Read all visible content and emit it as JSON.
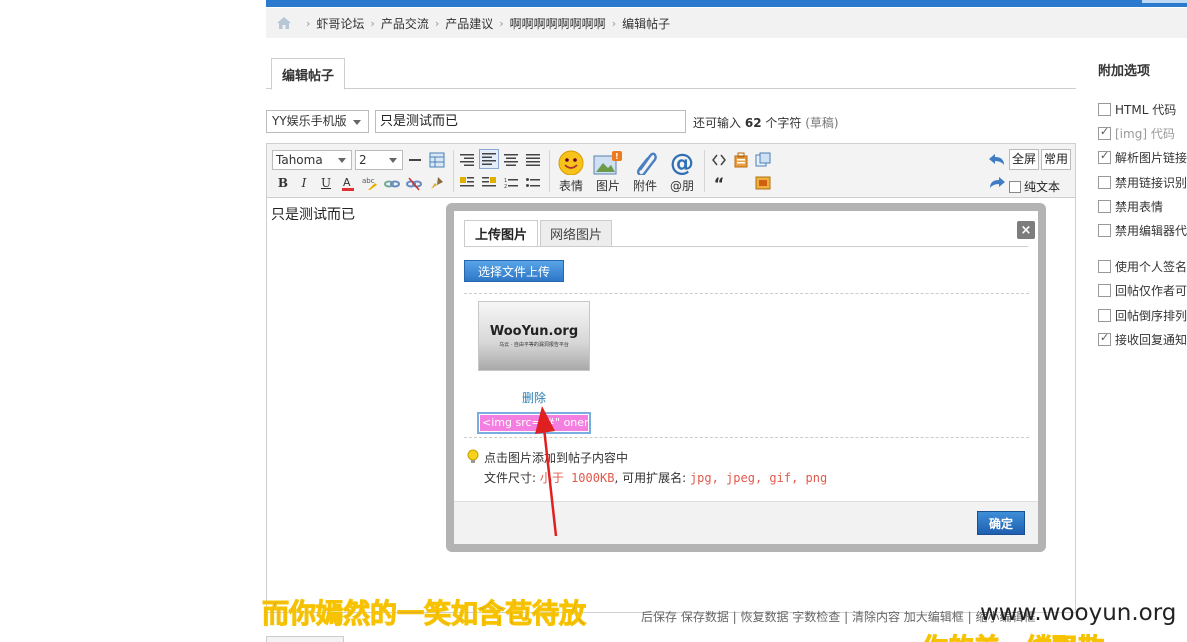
{
  "breadcrumb": {
    "items": [
      "虾哥论坛",
      "产品交流",
      "产品建议",
      "啊啊啊啊啊啊啊啊",
      "编辑帖子"
    ]
  },
  "page_tab": "编辑帖子",
  "post": {
    "category": "YY娱乐手机版",
    "subject": "只是测试而已",
    "remaining_prefix": "还可输入",
    "remaining_count": "62",
    "remaining_suffix": "个字符",
    "draft_label": "(草稿)",
    "body": "只是测试而已"
  },
  "toolbar": {
    "font": "Tahoma",
    "size": "2",
    "bold": "B",
    "italic": "I",
    "underline": "U",
    "quote": "“",
    "emoji": "表情",
    "image": "图片",
    "attachment": "附件",
    "mention": "@朋",
    "fullscreen": "全屏",
    "common": "常用",
    "plaintext": "纯文本"
  },
  "dialog": {
    "tab_upload": "上传图片",
    "tab_web": "网络图片",
    "close": "×",
    "upload_button": "选择文件上传",
    "thumb_brand": "WooYun.org",
    "thumb_sub": "乌云 · 自由平等的漏洞报告平台",
    "delete": "删除",
    "img_code": "<img src=\"#\" onerr",
    "hint_line1": "点击图片添加到帖子内容中",
    "hint_size_label": "文件尺寸: ",
    "hint_size_value": "小于 1000KB",
    "hint_ext_label": ", 可用扩展名: ",
    "hint_ext_value": "jpg, jpeg, gif, png",
    "ok": "确定"
  },
  "options": {
    "title": "附加选项",
    "items": [
      {
        "label": "HTML 代码",
        "checked": false,
        "disabled": false
      },
      {
        "label": "[img] 代码",
        "checked": true,
        "disabled": true
      },
      {
        "label": "解析图片链接",
        "checked": true,
        "disabled": false
      },
      {
        "label": "禁用链接识别",
        "checked": false,
        "disabled": false
      },
      {
        "label": "禁用表情",
        "checked": false,
        "disabled": false
      },
      {
        "label": "禁用编辑器代",
        "checked": false,
        "disabled": false
      },
      {
        "label": "使用个人签名",
        "checked": false,
        "disabled": false
      },
      {
        "label": "回帖仅作者可",
        "checked": false,
        "disabled": false
      },
      {
        "label": "回帖倒序排列",
        "checked": false,
        "disabled": false
      },
      {
        "label": "接收回复通知",
        "checked": true,
        "disabled": false
      }
    ]
  },
  "bottom_links": "后保存 保存数据 | 恢复数据   字数检查 | 清除内容   加大编辑框 | 缩小编辑框",
  "overlay": {
    "caption_part1": "而你嫣然的一笑如",
    "caption_part2": "含苞待放",
    "watermark": "www.wooyun.org",
    "caption2": "你的美一缕飘散"
  }
}
